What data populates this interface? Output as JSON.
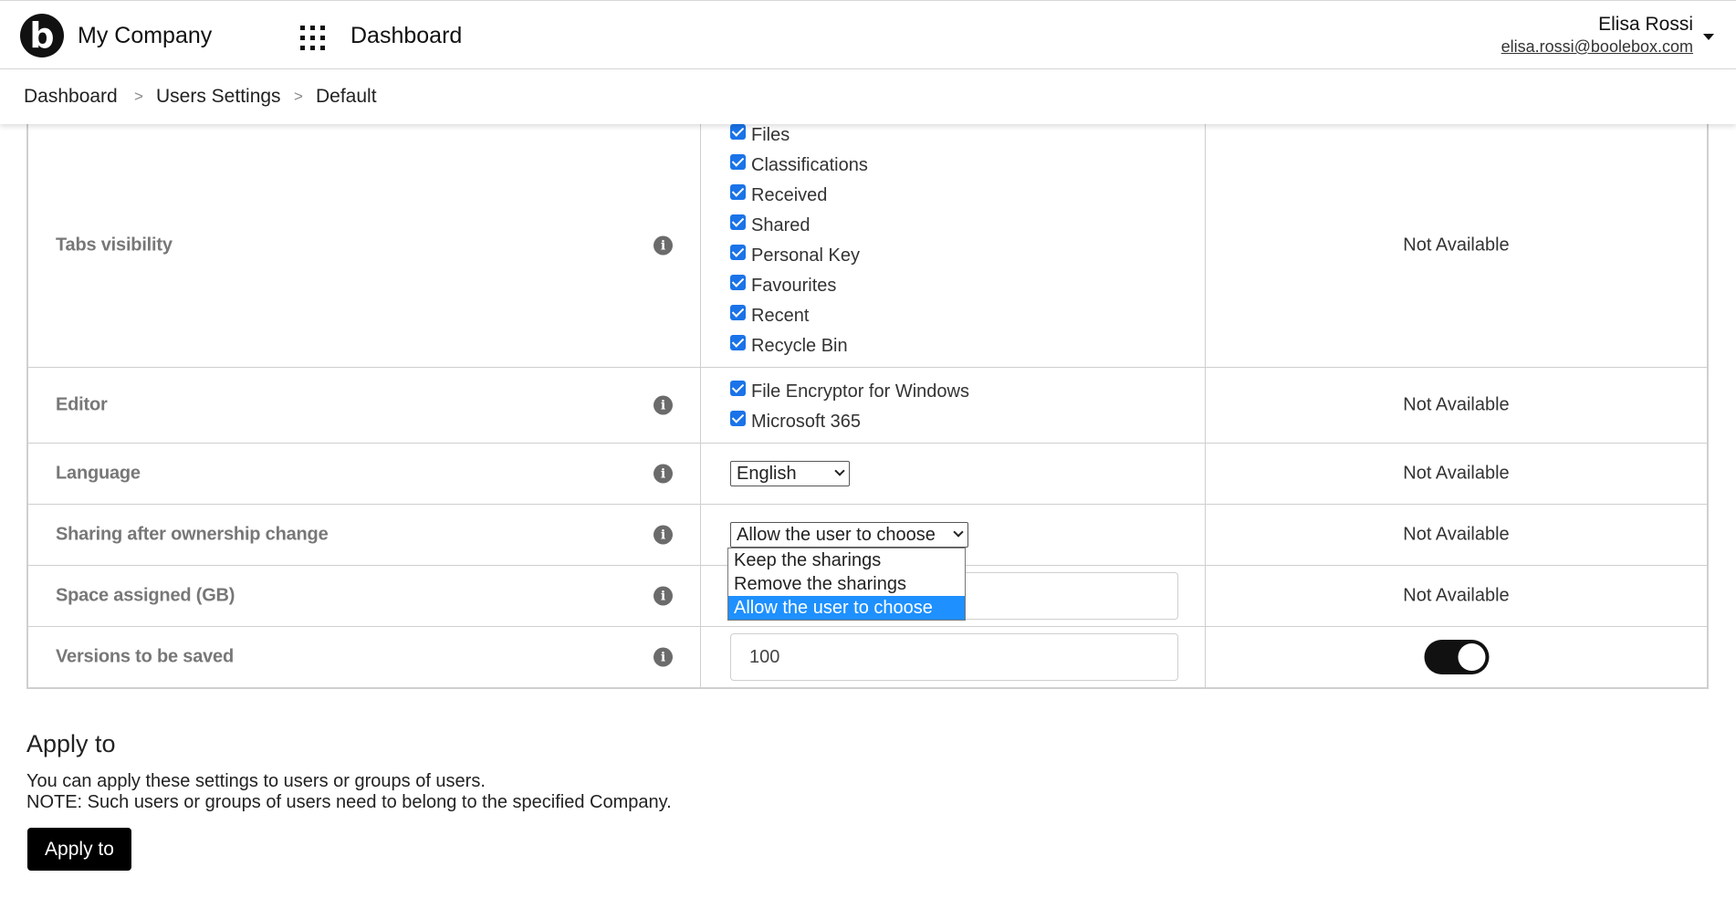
{
  "header": {
    "logo_letter": "b",
    "company_name": "My Company",
    "app_title": "Dashboard",
    "user_name": "Elisa Rossi",
    "user_email": "elisa.rossi@boolebox.com"
  },
  "breadcrumb": {
    "items": [
      "Dashboard",
      "Users Settings",
      "Default"
    ],
    "separator": ">"
  },
  "settings": {
    "tabs_visibility": {
      "label": "Tabs visibility",
      "options": [
        "Files",
        "Classifications",
        "Received",
        "Shared",
        "Personal Key",
        "Favourites",
        "Recent",
        "Recycle Bin"
      ],
      "checked": [
        true,
        true,
        true,
        true,
        true,
        true,
        true,
        true
      ],
      "default": "Not Available"
    },
    "editor": {
      "label": "Editor",
      "options": [
        "File Encryptor for Windows",
        "Microsoft 365"
      ],
      "checked": [
        true,
        true
      ],
      "default": "Not Available"
    },
    "language": {
      "label": "Language",
      "selected": "English",
      "default": "Not Available"
    },
    "sharing": {
      "label": "Sharing after ownership change",
      "selected": "Allow the user to choose",
      "options": [
        "Keep the sharings",
        "Remove the sharings",
        "Allow the user to choose"
      ],
      "highlighted_index": 2,
      "default": "Not Available"
    },
    "space": {
      "label": "Space assigned (GB)",
      "value": "",
      "default": "Not Available"
    },
    "versions": {
      "label": "Versions to be saved",
      "value": "100",
      "toggle_on": true
    }
  },
  "info_icon_glyph": "i",
  "apply": {
    "title": "Apply to",
    "description": "You can apply these settings to users or groups of users.",
    "note": "NOTE: Such users or groups of users need to belong to the specified Company.",
    "button_label": "Apply to"
  },
  "colors": {
    "checkbox": "#1a73e8",
    "highlight": "#1e90ff",
    "primary_button": "#000000"
  }
}
